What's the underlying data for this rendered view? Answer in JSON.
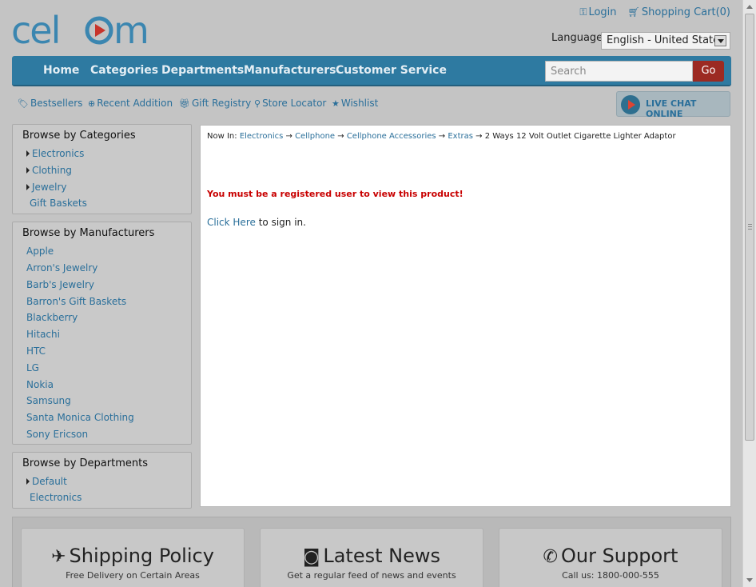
{
  "brand": {
    "logo_text": "celcom"
  },
  "topbar": {
    "login": "Login",
    "cart": "Shopping Cart(0)",
    "language_label": "Language:",
    "language_value": "English - United State"
  },
  "nav": {
    "items": [
      "Home",
      "Categories",
      "Departments",
      "Manufacturers",
      "Customer Service"
    ],
    "search_placeholder": "Search",
    "go": "Go"
  },
  "subnav": {
    "items": [
      "Bestsellers",
      "Recent Addition",
      "Gift Registry",
      "Store Locator",
      "Wishlist"
    ],
    "livechat": "LIVE CHAT ONLINE"
  },
  "sidebar": {
    "categories": {
      "title": "Browse by Categories",
      "items": [
        "Electronics",
        "Clothing",
        "Jewelry",
        "Gift Baskets"
      ]
    },
    "manufacturers": {
      "title": "Browse by Manufacturers",
      "items": [
        "Apple",
        "Arron's Jewelry",
        "Barb's Jewelry",
        "Barron's Gift Baskets",
        "Blackberry",
        "Hitachi",
        "HTC",
        "LG",
        "Nokia",
        "Samsung",
        "Santa Monica Clothing",
        "Sony Ericson"
      ]
    },
    "departments": {
      "title": "Browse by Departments",
      "items": [
        "Default",
        "Electronics"
      ]
    }
  },
  "main": {
    "breadcrumb": {
      "prefix": "Now In:",
      "links": [
        "Electronics",
        "Cellphone",
        "Cellphone Accessories",
        "Extras"
      ],
      "current": "2 Ways 12 Volt Outlet Cigarette Lighter Adaptor"
    },
    "warning": "You must be a registered user to view this product!",
    "signin_link": "Click Here",
    "signin_text": "to sign in."
  },
  "footer": {
    "boxes": [
      {
        "title": "Shipping Policy",
        "subtitle": "Free Delivery on Certain Areas"
      },
      {
        "title": "Latest News",
        "subtitle": "Get a regular feed of news and events"
      },
      {
        "title": "Our Support",
        "subtitle": "Call us: 1800-000-555"
      }
    ]
  },
  "colors": {
    "nav_bg": "#2e7aa1",
    "link": "#2a6f9a",
    "go_button": "#9c2a22",
    "warning": "#c80000"
  }
}
